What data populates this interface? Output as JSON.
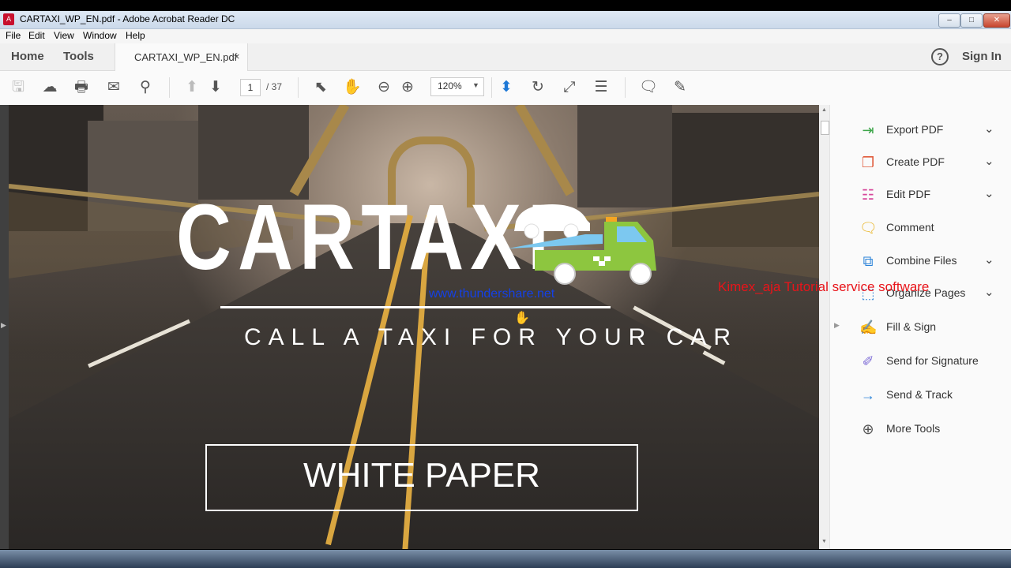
{
  "window": {
    "title": "CARTAXI_WP_EN.pdf - Adobe Acrobat Reader DC",
    "minimize": "–",
    "maximize": "□",
    "close": "✕"
  },
  "menu": [
    "File",
    "Edit",
    "View",
    "Window",
    "Help"
  ],
  "nav": {
    "home": "Home",
    "tools": "Tools",
    "doc_tab": "CARTAXI_WP_EN.pdf",
    "doc_tab_close": "×",
    "help": "?",
    "sign_in": "Sign In"
  },
  "toolbar": {
    "icons": [
      "save-icon",
      "cloud-upload-icon",
      "print-icon",
      "email-icon",
      "search-icon",
      "page-up-icon",
      "page-down-icon",
      "select-cursor-icon",
      "hand-tool-icon",
      "zoom-out-icon",
      "zoom-in-icon",
      "fit-page-icon",
      "rotate-icon",
      "fullscreen-icon",
      "scroll-mode-icon",
      "comment-icon",
      "highlight-pen-icon"
    ],
    "page_current": "1",
    "page_total": "/ 37",
    "zoom": "120%"
  },
  "document": {
    "logo": "CARTAXI",
    "tagline": "CALL A TAXI FOR YOUR CAR",
    "heading": "WHITE PAPER"
  },
  "tools_pane": [
    {
      "label": "Export PDF",
      "icon": "export-pdf-icon",
      "color": "#3da64a",
      "expandable": true
    },
    {
      "label": "Create PDF",
      "icon": "create-pdf-icon",
      "color": "#e05a3a",
      "expandable": true
    },
    {
      "label": "Edit PDF",
      "icon": "edit-pdf-icon",
      "color": "#d6479b",
      "expandable": true
    },
    {
      "label": "Comment",
      "icon": "comment-icon",
      "color": "#e8b21e",
      "expandable": false
    },
    {
      "label": "Combine Files",
      "icon": "combine-files-icon",
      "color": "#2a82d8",
      "expandable": true
    },
    {
      "label": "Organize Pages",
      "icon": "organize-pages-icon",
      "color": "#2a82d8",
      "expandable": true
    },
    {
      "label": "Fill & Sign",
      "icon": "fill-sign-icon",
      "color": "#7d6bd6",
      "expandable": false
    },
    {
      "label": "Send for Signature",
      "icon": "send-signature-icon",
      "color": "#7d6bd6",
      "expandable": false
    },
    {
      "label": "Send & Track",
      "icon": "send-track-icon",
      "color": "#2a82d8",
      "expandable": false
    },
    {
      "label": "More Tools",
      "icon": "more-tools-icon",
      "color": "#555555",
      "expandable": false
    }
  ],
  "overlay": {
    "watermark_url": "www.thundershare.net",
    "watermark_text": "Kimex_aja Tutorial service software"
  }
}
